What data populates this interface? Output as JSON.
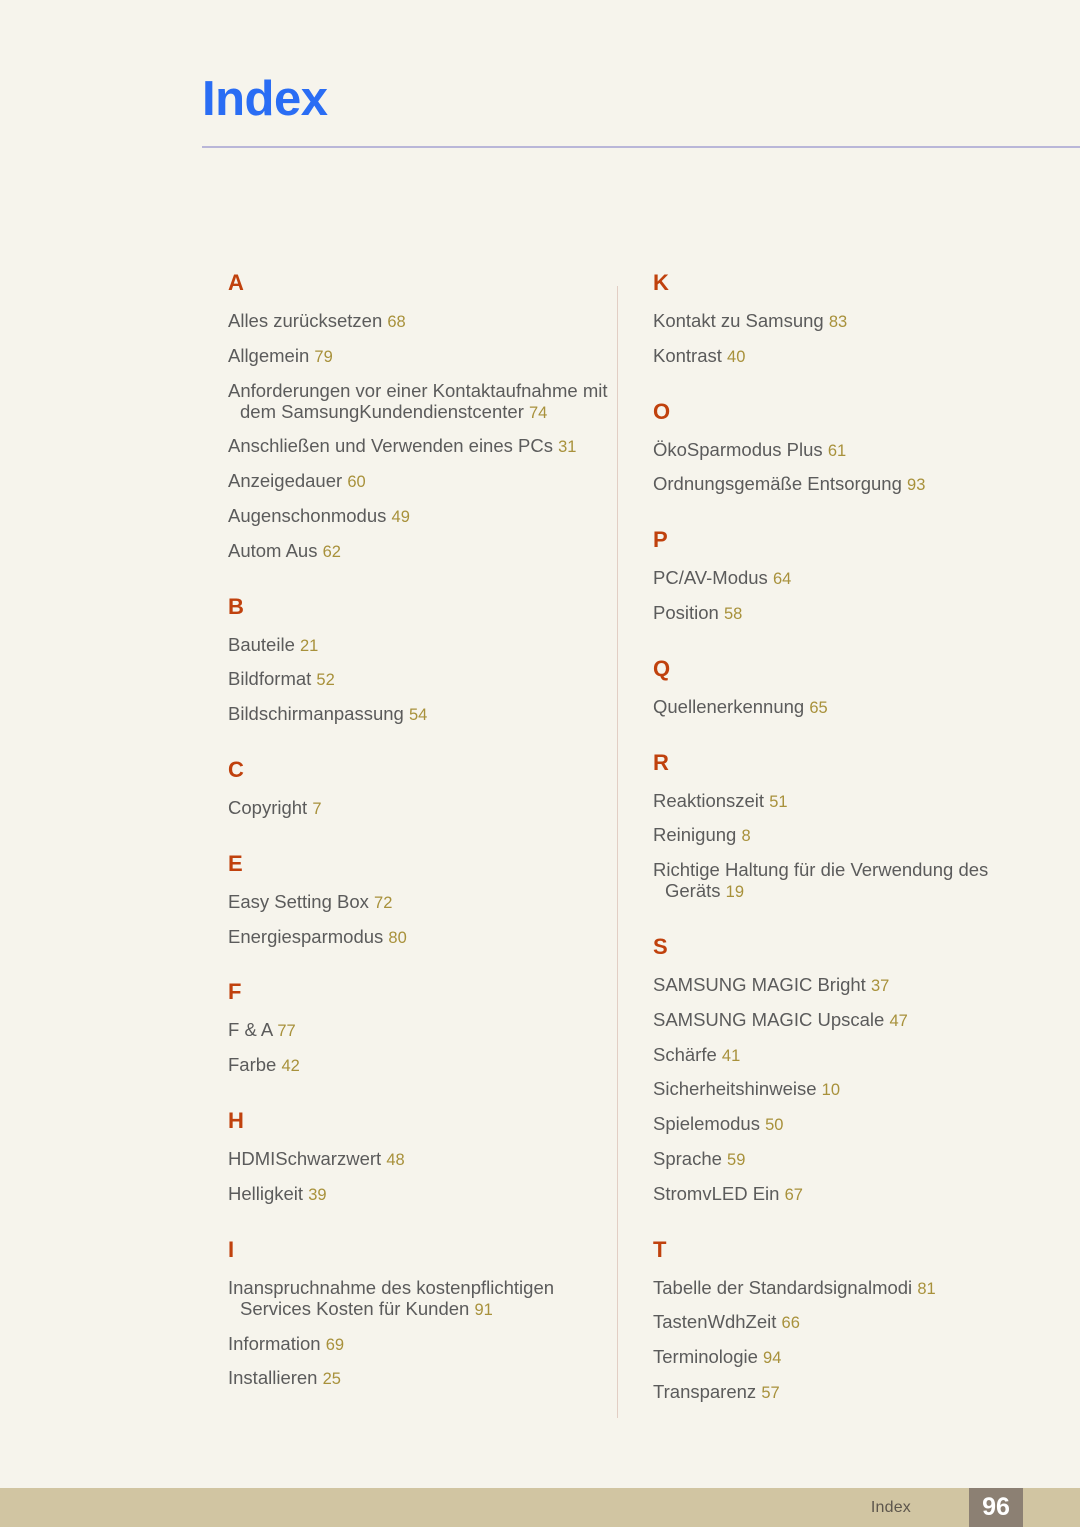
{
  "header": {
    "title": "Index",
    "rule": "horizontal-rule"
  },
  "colors": {
    "background": "#F6F4EC",
    "title": "#2A6DF4",
    "section_letter": "#C0410D",
    "entry_text": "#5B5B5B",
    "page_number": "#A8913B",
    "footer_band": "#D1C5A2",
    "footer_box": "#8C8073",
    "divider": "#E2CEC4",
    "title_rule": "#B9B6D8"
  },
  "index": {
    "columns": [
      {
        "name": "left",
        "sections": [
          {
            "letter": "A",
            "entries": [
              {
                "term": "Alles zurücksetzen",
                "page": "68"
              },
              {
                "term": "Allgemein",
                "page": "79"
              },
              {
                "term": "Anforderungen vor einer Kontaktaufnahme mit dem SamsungKundendienstcenter",
                "page": "74"
              },
              {
                "term": "Anschließen und Verwenden eines PCs",
                "page": "31"
              },
              {
                "term": "Anzeigedauer",
                "page": "60"
              },
              {
                "term": "Augenschonmodus",
                "page": "49"
              },
              {
                "term": "Autom Aus",
                "page": "62"
              }
            ]
          },
          {
            "letter": "B",
            "entries": [
              {
                "term": "Bauteile",
                "page": "21"
              },
              {
                "term": "Bildformat",
                "page": "52"
              },
              {
                "term": "Bildschirmanpassung",
                "page": "54"
              }
            ]
          },
          {
            "letter": "C",
            "entries": [
              {
                "term": "Copyright",
                "page": "7"
              }
            ]
          },
          {
            "letter": "E",
            "entries": [
              {
                "term": "Easy Setting Box",
                "page": "72"
              },
              {
                "term": "Energiesparmodus",
                "page": "80"
              }
            ]
          },
          {
            "letter": "F",
            "entries": [
              {
                "term": "F & A",
                "page": "77"
              },
              {
                "term": "Farbe",
                "page": "42"
              }
            ]
          },
          {
            "letter": "H",
            "entries": [
              {
                "term": "HDMISchwarzwert",
                "page": "48"
              },
              {
                "term": "Helligkeit",
                "page": "39"
              }
            ]
          },
          {
            "letter": "I",
            "entries": [
              {
                "term": "Inanspruchnahme des kostenpflichtigen Services Kosten für Kunden",
                "page": "91"
              },
              {
                "term": "Information",
                "page": "69"
              },
              {
                "term": "Installieren",
                "page": "25"
              }
            ]
          }
        ]
      },
      {
        "name": "right",
        "sections": [
          {
            "letter": "K",
            "entries": [
              {
                "term": "Kontakt zu Samsung",
                "page": "83"
              },
              {
                "term": "Kontrast",
                "page": "40"
              }
            ]
          },
          {
            "letter": "O",
            "entries": [
              {
                "term": "ÖkoSparmodus Plus",
                "page": "61"
              },
              {
                "term": "Ordnungsgemäße Entsorgung",
                "page": "93"
              }
            ]
          },
          {
            "letter": "P",
            "entries": [
              {
                "term": "PC/AV-Modus",
                "page": "64"
              },
              {
                "term": "Position",
                "page": "58"
              }
            ]
          },
          {
            "letter": "Q",
            "entries": [
              {
                "term": "Quellenerkennung",
                "page": "65"
              }
            ]
          },
          {
            "letter": "R",
            "entries": [
              {
                "term": "Reaktionszeit",
                "page": "51"
              },
              {
                "term": "Reinigung",
                "page": "8"
              },
              {
                "term": "Richtige Haltung für die Verwendung des Geräts",
                "page": "19"
              }
            ]
          },
          {
            "letter": "S",
            "entries": [
              {
                "term": "SAMSUNG MAGIC Bright",
                "page": "37"
              },
              {
                "term": "SAMSUNG MAGIC Upscale",
                "page": "47"
              },
              {
                "term": "Schärfe",
                "page": "41"
              },
              {
                "term": "Sicherheitshinweise",
                "page": "10"
              },
              {
                "term": "Spielemodus",
                "page": "50"
              },
              {
                "term": "Sprache",
                "page": "59"
              },
              {
                "term": "StromvLED Ein",
                "page": "67"
              }
            ]
          },
          {
            "letter": "T",
            "entries": [
              {
                "term": "Tabelle der Standardsignalmodi",
                "page": "81"
              },
              {
                "term": "TastenWdhZeit",
                "page": "66"
              },
              {
                "term": "Terminologie",
                "page": "94"
              },
              {
                "term": "Transparenz",
                "page": "57"
              }
            ]
          }
        ]
      }
    ]
  },
  "footer": {
    "label": "Index",
    "page_number": "96"
  }
}
